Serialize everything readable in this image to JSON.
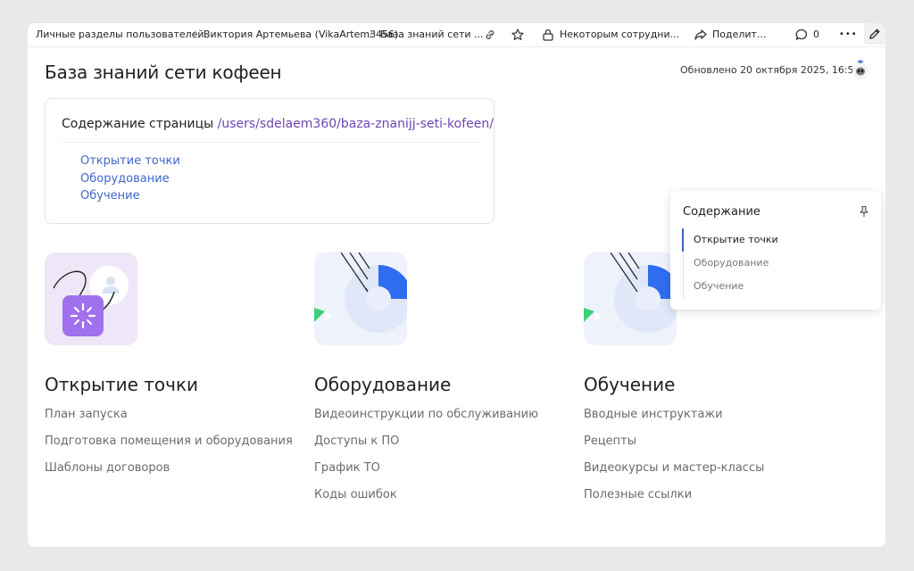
{
  "header": {
    "breadcrumbs": [
      "Личные разделы пользователей",
      "Виктория Артемьева (VikaArtem3456)",
      "База знаний сети ..."
    ],
    "access_label": "Некоторым сотрудни...",
    "share_label": "Поделит...",
    "comments_count": "0",
    "more_label": "•••"
  },
  "page": {
    "title": "База знаний сети кофеен",
    "updated": "Обновлено 20 октября 2025, 16:50"
  },
  "toc_card": {
    "heading": "Содержание страницы",
    "path": "/users/sdelaem360/baza-znanijj-seti-kofeen/",
    "links": [
      "Открытие точки",
      "Оборудование",
      "Обучение"
    ]
  },
  "sections": [
    {
      "title": "Открытие точки",
      "items": [
        "План запуска",
        "Подготовка помещения и оборудования",
        "Шаблоны договоров"
      ]
    },
    {
      "title": "Оборудование",
      "items": [
        "Видеоинструкции по обслуживанию",
        "Доступы к ПО",
        "График ТО",
        "Коды ошибок"
      ]
    },
    {
      "title": "Обучение",
      "items": [
        "Вводные инструктажи",
        "Рецепты",
        "Видеокурсы и мастер-классы",
        "Полезные ссылки"
      ]
    }
  ],
  "side_toc": {
    "title": "Содержание",
    "items": [
      "Открытие точки",
      "Оборудование",
      "Обучение"
    ],
    "active_index": 0
  },
  "colors": {
    "link": "#3d67c7",
    "path": "#6e45b3",
    "accent_purple": "#9b6ef0",
    "accent_blue": "#2f6cf0",
    "accent_green": "#3dd07a"
  }
}
